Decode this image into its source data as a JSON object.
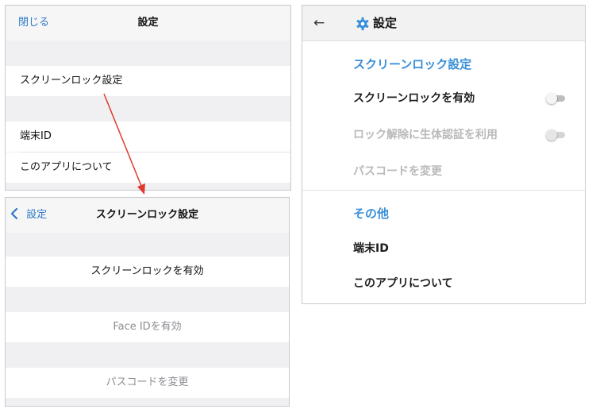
{
  "ios_settings": {
    "nav": {
      "close_label": "閉じる",
      "title": "設定"
    },
    "rows": [
      {
        "label": "スクリーンロック設定"
      },
      {
        "label": "端末ID"
      },
      {
        "label": "このアプリについて"
      }
    ]
  },
  "ios_screenlock": {
    "nav": {
      "back_label": "設定",
      "title": "スクリーンロック設定"
    },
    "rows": [
      {
        "label": "スクリーンロックを有効",
        "enabled": true
      },
      {
        "label": "Face IDを有効",
        "enabled": false
      },
      {
        "label": "パスコードを変更",
        "enabled": false
      }
    ]
  },
  "android_settings": {
    "header": {
      "back_icon": "arrow-left-icon",
      "settings_icon": "gear-icon",
      "title": "設定"
    },
    "sections": [
      {
        "title": "スクリーンロック設定",
        "items": [
          {
            "label": "スクリーンロックを有効",
            "toggle": "off",
            "enabled": true
          },
          {
            "label": "ロック解除に生体認証を利用",
            "toggle": "off",
            "enabled": false
          },
          {
            "label": "パスコードを変更",
            "enabled": false
          }
        ]
      },
      {
        "title": "その他",
        "items": [
          {
            "label": "端末ID",
            "enabled": true
          },
          {
            "label": "このアプリについて",
            "enabled": true
          }
        ]
      }
    ]
  },
  "colors": {
    "ios_accent": "#2f79c8",
    "android_accent": "#3a8fd9",
    "annotation_arrow": "#e0392f",
    "grouped_background": "#f0f0f2",
    "disabled_text": "#8e8e93"
  }
}
